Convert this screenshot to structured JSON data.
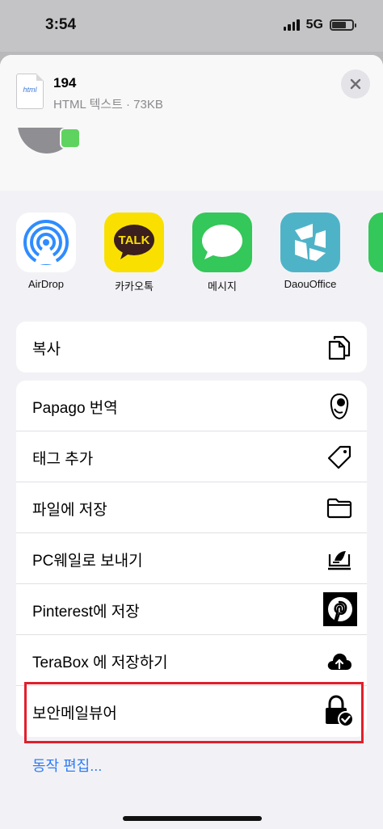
{
  "status": {
    "time": "3:54",
    "network": "5G"
  },
  "share_header": {
    "file_icon_text": "html",
    "file_name": "194",
    "file_meta": "HTML 텍스트 · 73KB"
  },
  "apps": [
    {
      "label": "AirDrop",
      "icon": "airdrop-icon",
      "color": "#2f8cff"
    },
    {
      "label": "카카오톡",
      "icon": "kakaotalk-icon",
      "icon_text": "TALK",
      "color": "#f9e000"
    },
    {
      "label": "메시지",
      "icon": "messages-icon",
      "color": "#34c759"
    },
    {
      "label": "DaouOffice",
      "icon": "daouoffice-icon",
      "color": "#4fb3c8"
    }
  ],
  "copy_group": [
    {
      "label": "복사",
      "icon": "copy-icon"
    }
  ],
  "actions": [
    {
      "label": "Papago 번역",
      "icon": "papago-icon"
    },
    {
      "label": "태그 추가",
      "icon": "tag-icon"
    },
    {
      "label": "파일에 저장",
      "icon": "folder-icon"
    },
    {
      "label": "PC웨일로 보내기",
      "icon": "whale-pc-icon"
    },
    {
      "label": "Pinterest에 저장",
      "icon": "pinterest-icon"
    },
    {
      "label": "TeraBox 에 저장하기",
      "icon": "cloud-upload-icon"
    },
    {
      "label": "보안메일뷰어",
      "icon": "secure-lock-icon"
    }
  ],
  "edit_actions_label": "동작 편집...",
  "colors": {
    "highlight": "#e0202c",
    "link": "#2f7cf6"
  }
}
